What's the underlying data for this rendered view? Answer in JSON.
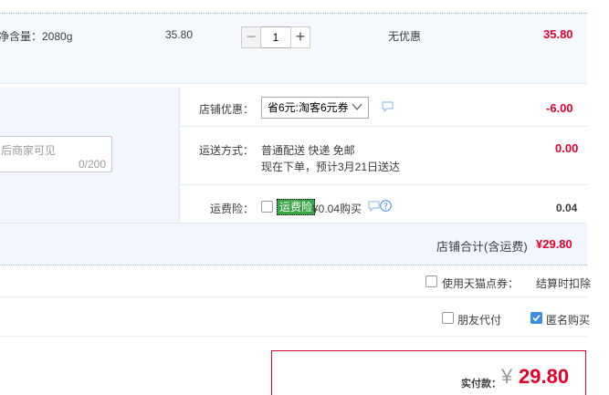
{
  "item": {
    "net_weight": "净含量：2080g",
    "unit_price": "35.80",
    "quantity": "1",
    "minus": "−",
    "plus": "+",
    "discount": "无优惠",
    "subtotal": "35.80"
  },
  "message": {
    "placeholder": "后商家可见",
    "counter": "0/200"
  },
  "shop_discount": {
    "label": "店铺优惠：",
    "selected": "省6元:淘客6元券",
    "amount": "-6.00"
  },
  "shipping": {
    "label": "运送方式：",
    "method": "普通配送 快递 免邮",
    "eta": "现在下单，预计3月21日送达",
    "amount": "0.00"
  },
  "insurance": {
    "label": "运费险：",
    "tag": "运费险",
    "price": "¥0.04购买",
    "amount": "0.04"
  },
  "shop_total": {
    "label": "店铺合计(含运费)",
    "amount": "¥29.80"
  },
  "coupon": {
    "label": "使用天猫点券：",
    "note": "结算时扣除"
  },
  "options": {
    "friend_pay": "朋友代付",
    "anonymous": "匿名购买"
  },
  "payment": {
    "label": "实付款：",
    "currency": "¥",
    "amount": "29.80"
  },
  "colors": {
    "price_red": "#e4002b",
    "section_bg": "#f2f7ff",
    "insurance_green": "#39a745",
    "checkbox_blue": "#3b8de0"
  }
}
